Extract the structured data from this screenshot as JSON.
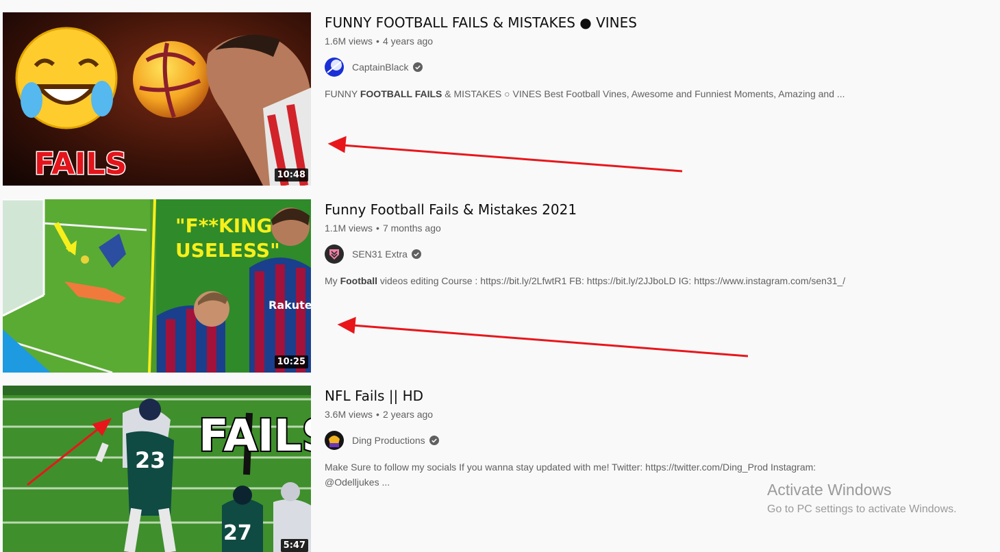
{
  "results": [
    {
      "title": "FUNNY FOOTBALL FAILS & MISTAKES ● VINES",
      "views": "1.6M views",
      "age": "4 years ago",
      "channel": "CaptainBlack",
      "duration": "10:48",
      "thumbnail_text": "FAILS",
      "desc_pre": "FUNNY ",
      "desc_bold": "FOOTBALL FAILS",
      "desc_post": " & MISTAKES ○ VINES Best Football Vines, Awesome and Funniest Moments, Amazing and ..."
    },
    {
      "title": "Funny Football Fails & Mistakes 2021",
      "views": "1.1M views",
      "age": "7 months ago",
      "channel": "SEN31 Extra",
      "duration": "10:25",
      "thumbnail_text_1": "\"F**KING",
      "thumbnail_text_2": "USELESS\"",
      "desc_pre": "My ",
      "desc_bold": "Football",
      "desc_post": " videos editing Course : https://bit.ly/2LfwtR1 FB: https://bit.ly/2JJboLD IG: https://www.instagram.com/sen31_/"
    },
    {
      "title": "NFL Fails || HD",
      "views": "3.6M views",
      "age": "2 years ago",
      "channel": "Ding Productions",
      "duration": "5:47",
      "thumbnail_text": "FAILS",
      "desc_line1": "Make Sure to follow my socials If you wanna stay updated with me! Twitter: https://twitter.com/Ding_Prod Instagram:",
      "desc_line2": "@Odelljukes ..."
    }
  ],
  "watermark": {
    "line1": "Activate Windows",
    "line2": "Go to PC settings to activate Windows."
  },
  "colors": {
    "annotation_arrow": "#e8161b",
    "meta_text": "#606060",
    "background": "#f9f9f9"
  }
}
